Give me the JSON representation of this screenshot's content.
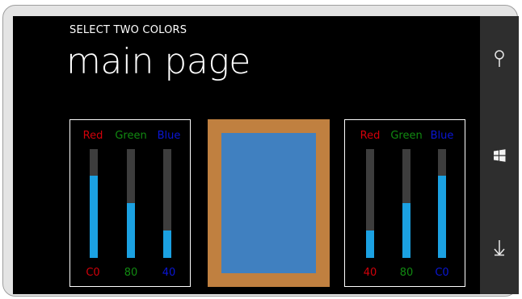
{
  "app": {
    "title": "SELECT TWO COLORS",
    "page_title": "main page"
  },
  "colors": {
    "label_red": "#d2000a",
    "label_green": "#118a11",
    "label_blue": "#0a16d6",
    "accent": "#1ba1e2",
    "border_color": "#c08040",
    "center_color": "#4080c0"
  },
  "left_panel": {
    "labels": {
      "red": "Red",
      "green": "Green",
      "blue": "Blue"
    },
    "values": {
      "red": "C0",
      "green": "80",
      "blue": "40"
    },
    "levels": {
      "red": 0.753,
      "green": 0.502,
      "blue": 0.251
    }
  },
  "right_panel": {
    "labels": {
      "red": "Red",
      "green": "Green",
      "blue": "Blue"
    },
    "values": {
      "red": "40",
      "green": "80",
      "blue": "C0"
    },
    "levels": {
      "red": 0.251,
      "green": 0.502,
      "blue": 0.753
    }
  },
  "nav": {
    "icons": [
      "search-icon",
      "windows-start-icon",
      "back-arrow-icon"
    ]
  }
}
